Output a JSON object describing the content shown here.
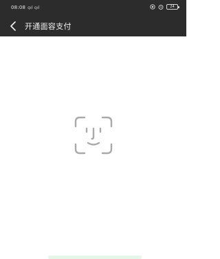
{
  "status_bar": {
    "time": "08:08",
    "signal_text": "ꞯıl ꞯıl",
    "battery_level": "24"
  },
  "navbar": {
    "title": "开通面容支付",
    "back_icon": "chevron-left-icon"
  },
  "main": {
    "face_icon": "face-id-icon"
  },
  "colors": {
    "topbar_bg": "#2c2c2c",
    "face_icon": "#a9a9a9",
    "bottom_accent": "#e7f6eb"
  }
}
